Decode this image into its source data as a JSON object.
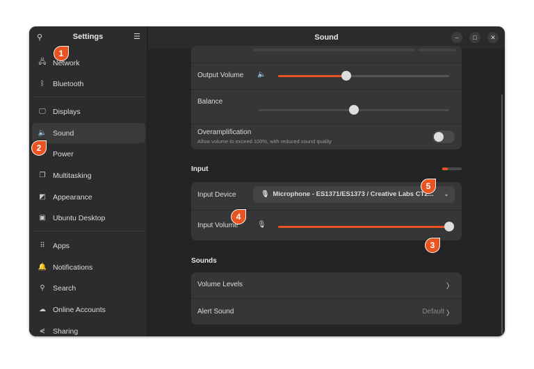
{
  "sidebar": {
    "title": "Settings",
    "search_icon": "search-icon",
    "menu_icon": "hamburger-menu-icon",
    "items": [
      {
        "label": "Network",
        "icon": "network-icon",
        "glyph": "🖧"
      },
      {
        "label": "Bluetooth",
        "icon": "bluetooth-icon",
        "glyph": "ᛒ"
      },
      {
        "label": "Displays",
        "icon": "display-icon",
        "glyph": "🖵"
      },
      {
        "label": "Sound",
        "icon": "speaker-icon",
        "glyph": "🔈",
        "selected": true
      },
      {
        "label": "Power",
        "icon": "power-icon",
        "glyph": ""
      },
      {
        "label": "Multitasking",
        "icon": "multitasking-icon",
        "glyph": "❐"
      },
      {
        "label": "Appearance",
        "icon": "appearance-icon",
        "glyph": "◩"
      },
      {
        "label": "Ubuntu Desktop",
        "icon": "ubuntu-desktop-icon",
        "glyph": "▣"
      },
      {
        "label": "Apps",
        "icon": "apps-icon",
        "glyph": "⠿"
      },
      {
        "label": "Notifications",
        "icon": "bell-icon",
        "glyph": "🔔"
      },
      {
        "label": "Search",
        "icon": "search-icon",
        "glyph": "⚲"
      },
      {
        "label": "Online Accounts",
        "icon": "cloud-icon",
        "glyph": "☁"
      },
      {
        "label": "Sharing",
        "icon": "share-icon",
        "glyph": "⋞"
      }
    ]
  },
  "header": {
    "title": "Sound"
  },
  "output": {
    "volume_label": "Output Volume",
    "volume_percent": 40,
    "balance_label": "Balance",
    "balance": 0.5,
    "overamp_label": "Overamplification",
    "overamp_desc": "Allow volume to exceed 100%, with reduced sound quality",
    "overamp_on": false
  },
  "input": {
    "header": "Input",
    "level_percent": 30,
    "device_label": "Input Device",
    "device_value": "Microphone - ES1371/ES1373 / Creative Labs CT2...",
    "volume_label": "Input Volume",
    "volume_percent": 100
  },
  "sounds": {
    "header": "Sounds",
    "volume_levels": "Volume Levels",
    "alert_sound": "Alert Sound",
    "alert_value": "Default"
  },
  "callouts": [
    "1",
    "2",
    "3",
    "4",
    "5"
  ],
  "accent": "#e95420"
}
